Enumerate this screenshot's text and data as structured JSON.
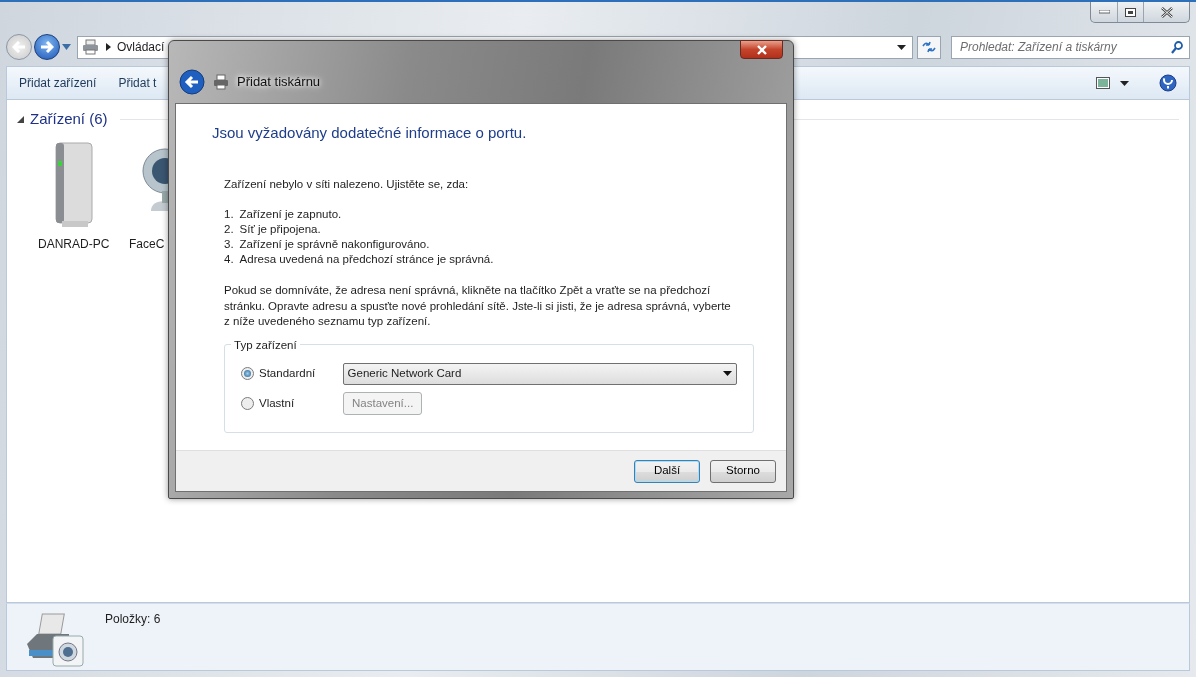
{
  "explorer": {
    "back": {
      "disabled": true
    },
    "forward": {
      "disabled": false
    },
    "breadcrumb": "Ovládací",
    "search": {
      "placeholder": "Prohledat: Zařízení a tiskárny"
    },
    "toolbar": [
      "Přidat zařízení",
      "Přidat t"
    ],
    "group": {
      "title": "Zařízení (6)",
      "expanded": true
    },
    "devices": [
      {
        "label": "DANRAD-PC",
        "kind": "computer"
      },
      {
        "label": "FaceC",
        "kind": "webcam"
      }
    ],
    "status": "Položky: 6"
  },
  "dialog": {
    "title": "Přidat tiskárnu",
    "heading": "Jsou vyžadovány dodatečné informace o portu.",
    "intro": "Zařízení nebylo v síti nalezeno. Ujistěte se, zda:",
    "checklist": [
      {
        "number": "1.",
        "text": "Zařízení je zapnuto."
      },
      {
        "number": "2.",
        "text": "Síť je připojena."
      },
      {
        "number": "3.",
        "text": "Zařízení je správně nakonfigurováno."
      },
      {
        "number": "4.",
        "text": "Adresa uvedená na předchozí stránce je správná."
      }
    ],
    "paragraph": "Pokud se domníváte, že adresa není správná, klikněte na tlačítko Zpět a vraťte se na předchozí stránku. Opravte adresu a spusťte nové prohledání sítě. Jste-li si jisti, že je adresa správná, vyberte z níže uvedeného seznamu typ zařízení.",
    "device_type": {
      "legend": "Typ zařízení",
      "options": [
        {
          "label": "Standardní",
          "selected": true,
          "kind": "select",
          "value": "Generic Network Card"
        },
        {
          "label": "Vlastní",
          "selected": false,
          "kind": "button",
          "value": "Nastavení...",
          "disabled": true
        }
      ]
    },
    "buttons": [
      {
        "label": "Další",
        "default": true
      },
      {
        "label": "Storno",
        "default": false
      }
    ]
  }
}
